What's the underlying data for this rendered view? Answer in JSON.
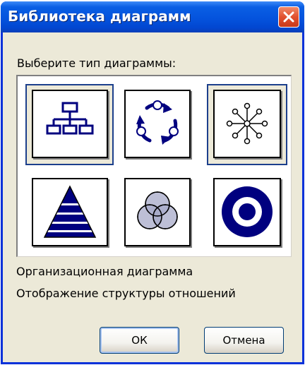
{
  "dialog": {
    "title": "Библиотека диаграмм",
    "prompt": "Выберите тип диаграммы:",
    "close_icon": "close-icon",
    "selected_type": "org-chart",
    "selected_label": "Организационная диаграмма",
    "selected_description": "Отображение структуры отношений",
    "ok_label": "ОК",
    "cancel_label": "Отмена"
  },
  "diagram_types": [
    {
      "icon": "org-chart-icon"
    },
    {
      "icon": "cycle-diagram-icon"
    },
    {
      "icon": "radial-diagram-icon"
    },
    {
      "icon": "pyramid-diagram-icon"
    },
    {
      "icon": "venn-diagram-icon"
    },
    {
      "icon": "target-diagram-icon"
    }
  ],
  "colors": {
    "title_bar": "#0453dd",
    "close_button": "#e2512f",
    "icon_navy": "#00007f",
    "dialog_bg": "#ece9d8"
  }
}
